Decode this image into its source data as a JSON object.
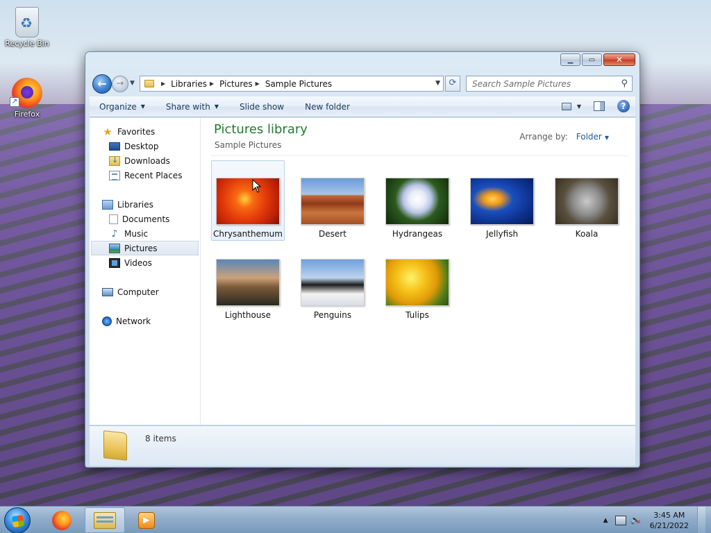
{
  "desktop": {
    "icons": [
      {
        "label": "Recycle Bin",
        "icon": "recycle-bin-icon"
      },
      {
        "label": "Firefox",
        "icon": "firefox-icon"
      }
    ]
  },
  "window": {
    "title": "",
    "caption_buttons": [
      "minimize",
      "maximize",
      "close"
    ],
    "address": {
      "crumbs": [
        "Libraries",
        "Pictures",
        "Sample Pictures"
      ]
    },
    "search": {
      "placeholder": "Search Sample Pictures"
    },
    "toolbar": {
      "organize": "Organize",
      "share_with": "Share with",
      "slide_show": "Slide show",
      "new_folder": "New folder"
    },
    "navpane": {
      "favorites": "Favorites",
      "desktop": "Desktop",
      "downloads": "Downloads",
      "recent_places": "Recent Places",
      "libraries": "Libraries",
      "documents": "Documents",
      "music": "Music",
      "pictures": "Pictures",
      "videos": "Videos",
      "computer": "Computer",
      "network": "Network"
    },
    "content": {
      "library_title": "Pictures library",
      "library_subtitle": "Sample Pictures",
      "arrange_label": "Arrange by:",
      "arrange_value": "Folder",
      "items": [
        {
          "label": "Chrysanthemum"
        },
        {
          "label": "Desert"
        },
        {
          "label": "Hydrangeas"
        },
        {
          "label": "Jellyfish"
        },
        {
          "label": "Koala"
        },
        {
          "label": "Lighthouse"
        },
        {
          "label": "Penguins"
        },
        {
          "label": "Tulips"
        }
      ]
    },
    "details": {
      "item_count": "8 items"
    }
  },
  "taskbar": {
    "pinned": [
      "firefox-icon",
      "windows-explorer-icon",
      "media-player-icon"
    ],
    "active": "windows-explorer-icon",
    "clock_time": "3:45 AM",
    "clock_date": "6/21/2022"
  }
}
